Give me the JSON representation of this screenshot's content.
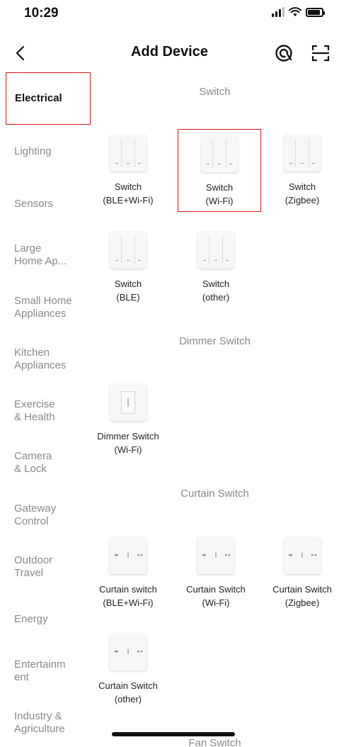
{
  "status_bar": {
    "time": "10:29"
  },
  "header": {
    "title": "Add Device"
  },
  "sidebar": {
    "items": [
      {
        "label": "Electrical",
        "active": true
      },
      {
        "label": "Lighting"
      },
      {
        "label": "Sensors"
      },
      {
        "label": "Large\nHome Ap..."
      },
      {
        "label": "Small Home\nAppliances"
      },
      {
        "label": "Kitchen\nAppliances"
      },
      {
        "label": "Exercise\n& Health"
      },
      {
        "label": "Camera\n& Lock"
      },
      {
        "label": "Gateway\nControl"
      },
      {
        "label": "Outdoor\nTravel"
      },
      {
        "label": "Energy"
      },
      {
        "label": "Entertainm\nent"
      },
      {
        "label": "Industry &\nAgriculture"
      }
    ]
  },
  "sections": {
    "switch": {
      "title": "Switch",
      "items": [
        {
          "line1": "Switch",
          "line2": "(BLE+Wi-Fi)"
        },
        {
          "line1": "Switch",
          "line2": "(Wi-Fi)"
        },
        {
          "line1": "Switch",
          "line2": "(Zigbee)"
        },
        {
          "line1": "Switch",
          "line2": "(BLE)"
        },
        {
          "line1": "Switch",
          "line2": "(other)"
        }
      ]
    },
    "dimmer": {
      "title": "Dimmer Switch",
      "items": [
        {
          "line1": "Dimmer Switch",
          "line2": "(Wi-Fi)"
        }
      ]
    },
    "curtain": {
      "title": "Curtain Switch",
      "items": [
        {
          "line1": "Curtain switch",
          "line2": "(BLE+Wi-Fi)"
        },
        {
          "line1": "Curtain Switch",
          "line2": "(Wi-Fi)"
        },
        {
          "line1": "Curtain Switch",
          "line2": "(Zigbee)"
        },
        {
          "line1": "Curtain Switch",
          "line2": "(other)"
        }
      ]
    },
    "fan": {
      "title": "Fan Switch"
    }
  },
  "colors": {
    "selection": "#e0151b",
    "muted_text": "#8a8a8a"
  }
}
